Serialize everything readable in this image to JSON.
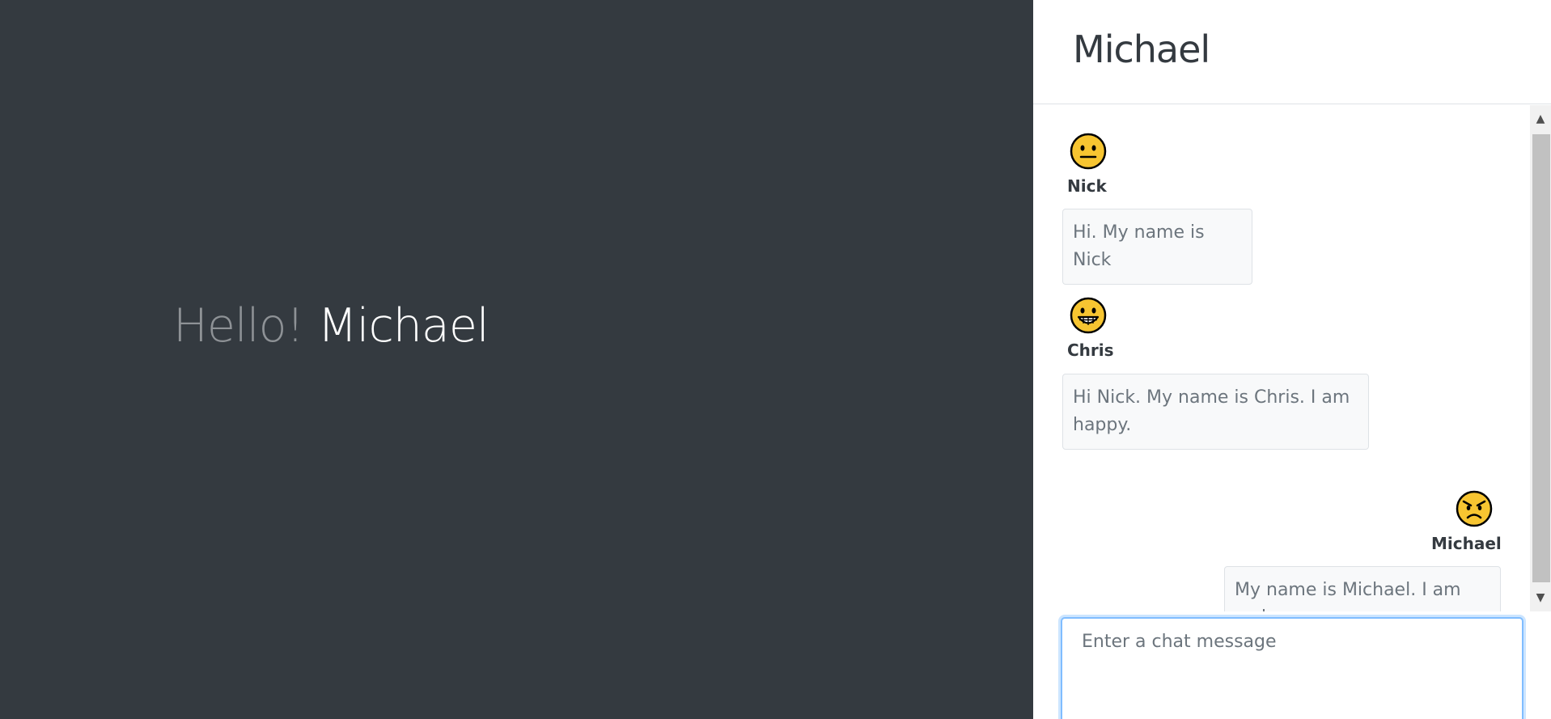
{
  "greeting": {
    "hello": "Hello!",
    "name": "Michael"
  },
  "chat": {
    "title": "Michael",
    "messages": [
      {
        "author": "Nick",
        "text": "Hi. My name is Nick",
        "mood": "neutral-face-icon",
        "align": "left"
      },
      {
        "author": "Chris",
        "text": "Hi Nick. My name is Chris. I am happy.",
        "mood": "grinning-face-icon",
        "align": "left"
      },
      {
        "author": "Michael",
        "text": "My name is Michael. I am sad.",
        "mood": "angry-face-icon",
        "align": "right"
      }
    ],
    "input": {
      "placeholder": "Enter a chat message",
      "value": ""
    }
  },
  "colors": {
    "background": "#343a40",
    "hello_text": "#8e9296",
    "name_text": "#ffffff",
    "bubble_bg": "#f8f9fa",
    "emoji_yellow": "#f7c531"
  }
}
